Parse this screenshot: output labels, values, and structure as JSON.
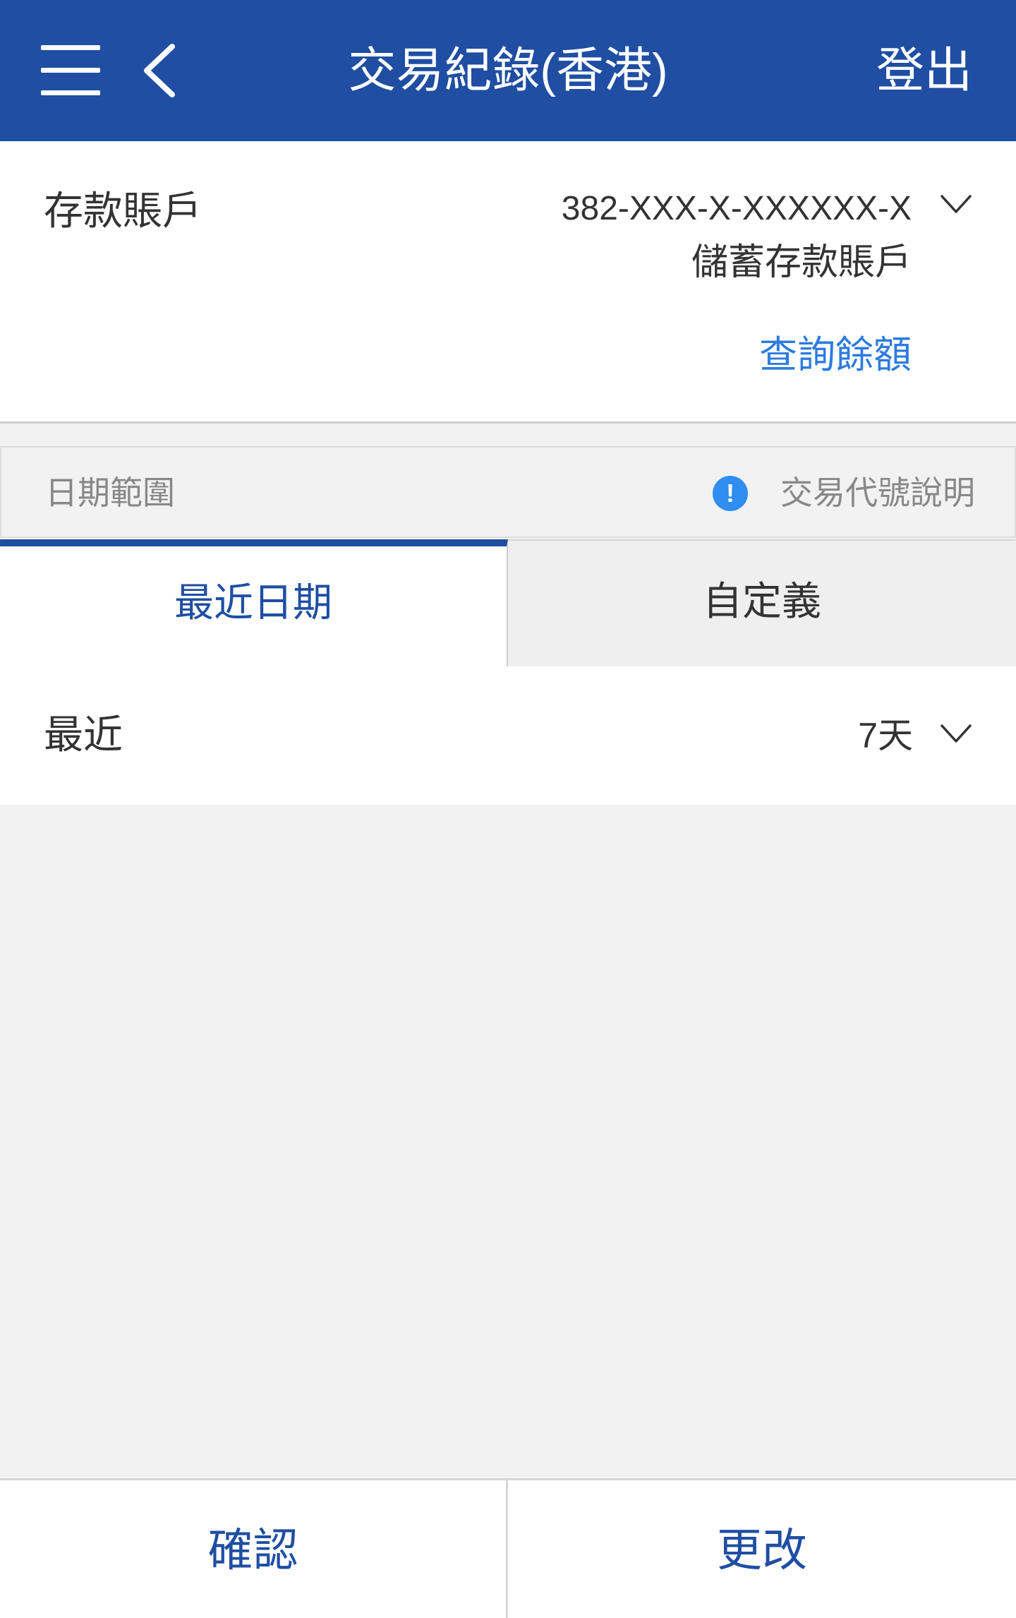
{
  "header": {
    "title": "交易紀錄(香港)",
    "logout_label": "登出",
    "background_color": "#1f4ea3"
  },
  "account": {
    "label": "存款賬戶",
    "number": "382-XXX-X-XXXXXX-X",
    "type": "儲蓄存款賬戶",
    "balance_link": "查詢餘額"
  },
  "date_range": {
    "label": "日期範圍",
    "info_symbol": "!",
    "code_link": "交易代號說明"
  },
  "tabs": [
    {
      "label": "最近日期",
      "active": true
    },
    {
      "label": "自定義",
      "active": false
    }
  ],
  "recent": {
    "label": "最近",
    "value": "7天"
  },
  "actions": {
    "confirm_label": "確認",
    "change_label": "更改"
  },
  "icons": {
    "menu": "hamburger-menu-icon",
    "back": "chevron-left-icon",
    "dropdown": "chevron-down-icon",
    "info": "info-icon"
  },
  "colors": {
    "accent": "#1f4ea3",
    "link": "#2d7be0",
    "info": "#2f8ef0"
  }
}
